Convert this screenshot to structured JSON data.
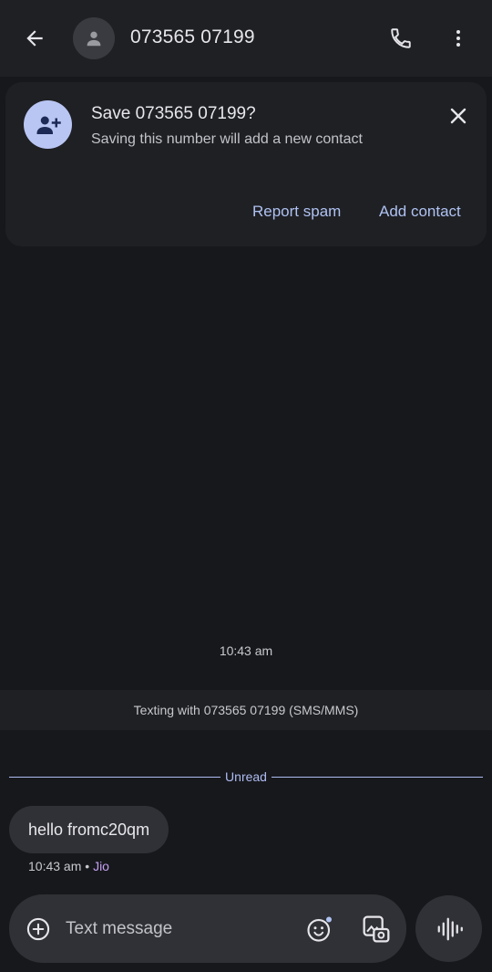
{
  "header": {
    "title": "073565 07199",
    "icons": {
      "back": "arrow-back-icon",
      "avatar": "person-icon",
      "call": "phone-icon",
      "more": "more-vert-icon"
    }
  },
  "save_card": {
    "title": "Save 073565 07199?",
    "subtitle": "Saving this number will add a new contact",
    "report_spam_label": "Report spam",
    "add_contact_label": "Add contact",
    "icons": {
      "avatar": "person-add-icon",
      "close": "close-icon"
    }
  },
  "conversation": {
    "timestamp": "10:43 am",
    "texting_banner": "Texting with 073565 07199 (SMS/MMS)",
    "unread_label": "Unread",
    "messages": [
      {
        "text": "hello fromc20qm",
        "time": "10:43 am",
        "separator": "•",
        "carrier": "Jio"
      }
    ]
  },
  "composer": {
    "placeholder": "Text message",
    "icons": {
      "add": "add-circle-icon",
      "emoji": "emoji-icon",
      "gallery": "gallery-icon",
      "voice": "voice-waveform-icon"
    }
  },
  "colors": {
    "background": "#17181c",
    "surface": "#1f2024",
    "bubble": "#303136",
    "accent": "#aec2f2",
    "carrier": "#c59ff2"
  }
}
